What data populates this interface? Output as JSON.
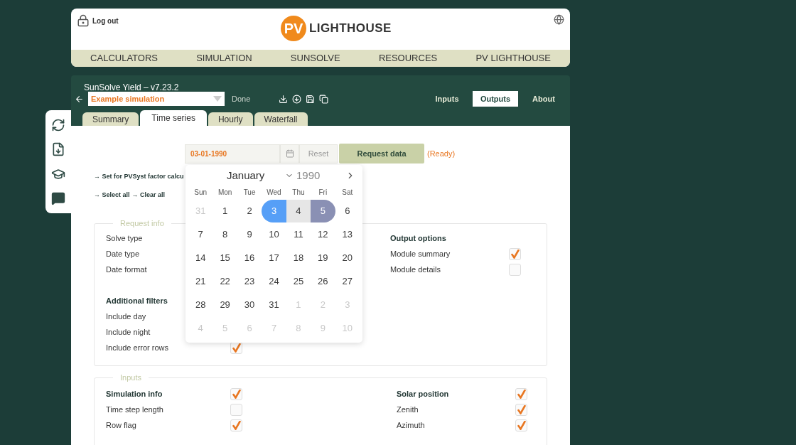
{
  "header": {
    "logout": "Log out",
    "logo_mark": "PV",
    "logo_text": "LIGHTHOUSE"
  },
  "nav": [
    "CALCULATORS",
    "SIMULATION",
    "SUNSOLVE",
    "RESOURCES",
    "PV LIGHTHOUSE"
  ],
  "app": {
    "title": "SunSolve Yield – v7.23.2",
    "simulation": "Example simulation",
    "status": "Done",
    "views": [
      {
        "label": "Inputs",
        "selected": false
      },
      {
        "label": "Outputs",
        "selected": true
      },
      {
        "label": "About",
        "selected": false
      }
    ],
    "tabs": [
      {
        "label": "Summary",
        "selected": false
      },
      {
        "label": "Time series",
        "selected": true
      },
      {
        "label": "Hourly",
        "selected": false
      },
      {
        "label": "Waterfall",
        "selected": false
      }
    ]
  },
  "request": {
    "date": "03-01-1990",
    "reset": "Reset",
    "button": "Request data",
    "state": "(Ready)"
  },
  "links": [
    {
      "parts": [
        "→ Set for PVSyst factor calcu"
      ]
    },
    {
      "parts": [
        "→ Select all",
        "→ Clear all"
      ]
    }
  ],
  "calendar": {
    "month": "January",
    "year": "1990",
    "weekdays": [
      "Sun",
      "Mon",
      "Tue",
      "Wed",
      "Thu",
      "Fri",
      "Sat"
    ],
    "days": [
      {
        "label": "31",
        "outside": true,
        "selected": false,
        "in_range": false
      },
      {
        "label": "1",
        "outside": false,
        "selected": false,
        "in_range": false
      },
      {
        "label": "2",
        "outside": false,
        "selected": false,
        "in_range": false
      },
      {
        "label": "3",
        "outside": false,
        "selected": true,
        "in_range": false
      },
      {
        "label": "4",
        "outside": false,
        "selected": false,
        "in_range": true
      },
      {
        "label": "5",
        "outside": false,
        "selected": true,
        "in_range": false
      },
      {
        "label": "6",
        "outside": false,
        "selected": false,
        "in_range": false
      },
      {
        "label": "7",
        "outside": false,
        "selected": false,
        "in_range": false
      },
      {
        "label": "8",
        "outside": false,
        "selected": false,
        "in_range": false
      },
      {
        "label": "9",
        "outside": false,
        "selected": false,
        "in_range": false
      },
      {
        "label": "10",
        "outside": false,
        "selected": false,
        "in_range": false
      },
      {
        "label": "11",
        "outside": false,
        "selected": false,
        "in_range": false
      },
      {
        "label": "12",
        "outside": false,
        "selected": false,
        "in_range": false
      },
      {
        "label": "13",
        "outside": false,
        "selected": false,
        "in_range": false
      },
      {
        "label": "14",
        "outside": false,
        "selected": false,
        "in_range": false
      },
      {
        "label": "15",
        "outside": false,
        "selected": false,
        "in_range": false
      },
      {
        "label": "16",
        "outside": false,
        "selected": false,
        "in_range": false
      },
      {
        "label": "17",
        "outside": false,
        "selected": false,
        "in_range": false
      },
      {
        "label": "18",
        "outside": false,
        "selected": false,
        "in_range": false
      },
      {
        "label": "19",
        "outside": false,
        "selected": false,
        "in_range": false
      },
      {
        "label": "20",
        "outside": false,
        "selected": false,
        "in_range": false
      },
      {
        "label": "21",
        "outside": false,
        "selected": false,
        "in_range": false
      },
      {
        "label": "22",
        "outside": false,
        "selected": false,
        "in_range": false
      },
      {
        "label": "23",
        "outside": false,
        "selected": false,
        "in_range": false
      },
      {
        "label": "24",
        "outside": false,
        "selected": false,
        "in_range": false
      },
      {
        "label": "25",
        "outside": false,
        "selected": false,
        "in_range": false
      },
      {
        "label": "26",
        "outside": false,
        "selected": false,
        "in_range": false
      },
      {
        "label": "27",
        "outside": false,
        "selected": false,
        "in_range": false
      },
      {
        "label": "28",
        "outside": false,
        "selected": false,
        "in_range": false
      },
      {
        "label": "29",
        "outside": false,
        "selected": false,
        "in_range": false
      },
      {
        "label": "30",
        "outside": false,
        "selected": false,
        "in_range": false
      },
      {
        "label": "31",
        "outside": false,
        "selected": false,
        "in_range": false
      },
      {
        "label": "1",
        "outside": true,
        "selected": false,
        "in_range": false
      },
      {
        "label": "2",
        "outside": true,
        "selected": false,
        "in_range": false
      },
      {
        "label": "3",
        "outside": true,
        "selected": false,
        "in_range": false
      },
      {
        "label": "4",
        "outside": true,
        "selected": false,
        "in_range": false
      },
      {
        "label": "5",
        "outside": true,
        "selected": false,
        "in_range": false
      },
      {
        "label": "6",
        "outside": true,
        "selected": false,
        "in_range": false
      },
      {
        "label": "7",
        "outside": true,
        "selected": false,
        "in_range": false
      },
      {
        "label": "8",
        "outside": true,
        "selected": false,
        "in_range": false
      },
      {
        "label": "9",
        "outside": true,
        "selected": false,
        "in_range": false
      },
      {
        "label": "10",
        "outside": true,
        "selected": false,
        "in_range": false
      }
    ]
  },
  "request_info": {
    "legend": "Request info",
    "left": [
      {
        "kind": "label",
        "label": "Solve type"
      },
      {
        "kind": "label",
        "label": "Date type"
      },
      {
        "kind": "label",
        "label": "Date format"
      },
      {
        "kind": "gap"
      },
      {
        "kind": "heading",
        "label": "Additional filters"
      },
      {
        "kind": "label",
        "label": "Include day"
      },
      {
        "kind": "label",
        "label": "Include night"
      },
      {
        "kind": "check",
        "label": "Include error rows",
        "checked": true
      }
    ],
    "right": [
      {
        "kind": "heading",
        "label": "Output options"
      },
      {
        "kind": "check",
        "label": "Module summary",
        "checked": true
      },
      {
        "kind": "check",
        "label": "Module details",
        "checked": false
      }
    ]
  },
  "inputs": {
    "legend": "Inputs",
    "left": [
      {
        "kind": "heading-check",
        "label": "Simulation info",
        "checked": true
      },
      {
        "kind": "check",
        "label": "Time step length",
        "checked": false
      },
      {
        "kind": "check",
        "label": "Row flag",
        "checked": true
      }
    ],
    "right": [
      {
        "kind": "heading-check",
        "label": "Solar position",
        "checked": true
      },
      {
        "kind": "check",
        "label": "Zenith",
        "checked": true
      },
      {
        "kind": "check",
        "label": "Azimuth",
        "checked": true
      }
    ]
  }
}
